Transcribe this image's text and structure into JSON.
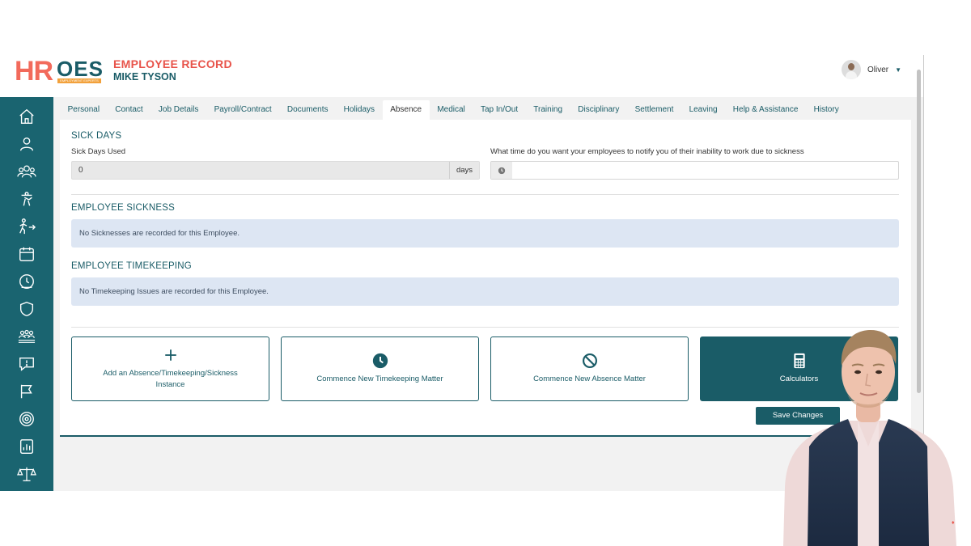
{
  "header": {
    "logo_hr": "HR",
    "logo_oes": "OES",
    "logo_tagline": "EMPLOYMENT EXPERTS",
    "record_title": "EMPLOYEE RECORD",
    "employee_name": "MIKE TYSON"
  },
  "user": {
    "name": "Oliver"
  },
  "sidebar": {
    "items": [
      {
        "icon": "home-icon"
      },
      {
        "icon": "user-icon"
      },
      {
        "icon": "users-group-icon"
      },
      {
        "icon": "worker-icon"
      },
      {
        "icon": "leaving-person-icon"
      },
      {
        "icon": "calendar-icon"
      },
      {
        "icon": "clock-icon"
      },
      {
        "icon": "shield-icon"
      },
      {
        "icon": "team-icon"
      },
      {
        "icon": "alert-message-icon"
      },
      {
        "icon": "flag-icon"
      },
      {
        "icon": "target-icon"
      },
      {
        "icon": "report-chart-icon"
      },
      {
        "icon": "scales-icon"
      }
    ]
  },
  "tabs": [
    {
      "label": "Personal"
    },
    {
      "label": "Contact"
    },
    {
      "label": "Job Details"
    },
    {
      "label": "Payroll/Contract"
    },
    {
      "label": "Documents"
    },
    {
      "label": "Holidays"
    },
    {
      "label": "Absence",
      "active": true
    },
    {
      "label": "Medical"
    },
    {
      "label": "Tap In/Out"
    },
    {
      "label": "Training"
    },
    {
      "label": "Disciplinary"
    },
    {
      "label": "Settlement"
    },
    {
      "label": "Leaving"
    },
    {
      "label": "Help & Assistance"
    },
    {
      "label": "History"
    }
  ],
  "sick_days": {
    "title": "SICK DAYS",
    "used_label": "Sick Days Used",
    "used_value": "0",
    "unit": "days",
    "notify_label": "What time do you want your employees to notify you of their inability to work due to sickness",
    "notify_value": ""
  },
  "sickness": {
    "title": "EMPLOYEE SICKNESS",
    "empty_message": "No Sicknesses are recorded for this Employee."
  },
  "timekeeping": {
    "title": "EMPLOYEE TIMEKEEPING",
    "empty_message": "No Timekeeping Issues are recorded for this Employee."
  },
  "actions": [
    {
      "label": "Add an Absence/Timekeeping/Sickness Instance",
      "icon": "plus-icon"
    },
    {
      "label": "Commence New Timekeeping Matter",
      "icon": "clock-icon"
    },
    {
      "label": "Commence New Absence Matter",
      "icon": "prohibited-icon"
    },
    {
      "label": "Calculators",
      "icon": "calculator-icon"
    }
  ],
  "save_label": "Save Changes",
  "colors": {
    "primary": "#1a5c67",
    "accent": "#e8544b",
    "info_bg": "#dde6f3"
  }
}
